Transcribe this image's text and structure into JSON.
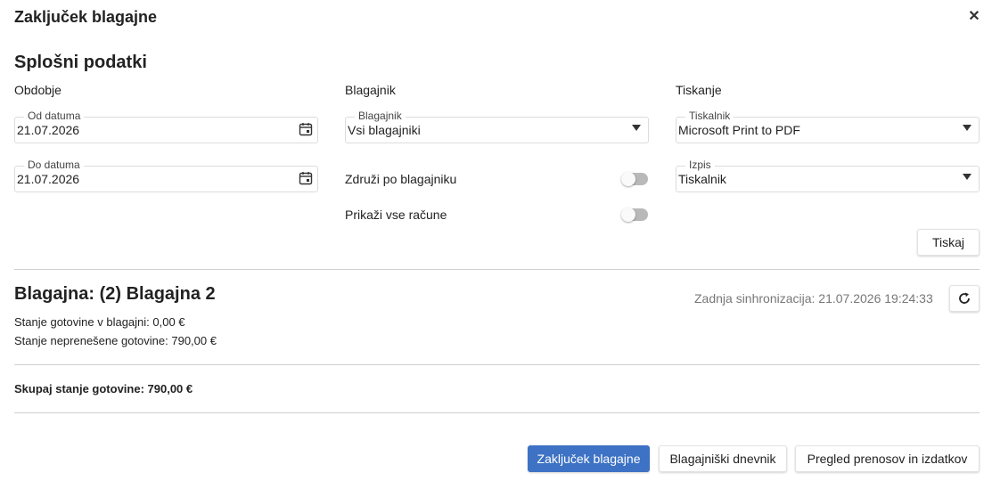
{
  "dialog": {
    "title": "Zaključek blagajne",
    "close_symbol": "✕"
  },
  "general": {
    "section_title": "Splošni podatki",
    "period": {
      "label": "Obdobje",
      "from": {
        "legend": "Od datuma",
        "value": "21.07.2026",
        "icon": "calendar-icon"
      },
      "to": {
        "legend": "Do datuma",
        "value": "21.07.2026",
        "icon": "calendar-icon"
      }
    },
    "cashier": {
      "label": "Blagajnik",
      "select": {
        "legend": "Blagajnik",
        "value": "Vsi blagajniki"
      },
      "group_by_toggle": {
        "label": "Združi po blagajniku",
        "on": false
      },
      "show_all_toggle": {
        "label": "Prikaži vse račune",
        "on": false
      }
    },
    "printing": {
      "label": "Tiskanje",
      "printer": {
        "legend": "Tiskalnik",
        "value": "Microsoft Print to PDF"
      },
      "output": {
        "legend": "Izpis",
        "value": "Tiskalnik"
      },
      "print_button": "Tiskaj"
    }
  },
  "register": {
    "title": "Blagajna: (2) Blagajna 2",
    "last_sync": "Zadnja sinhronizacija: 21.07.2026 19:24:33",
    "refresh_icon": "refresh-icon",
    "cash_balance": "Stanje gotovine v blagajni: 0,00 €",
    "untransferred_cash": "Stanje neprenešene gotovine: 790,00 €",
    "total": "Skupaj stanje gotovine: 790,00 €"
  },
  "footer": {
    "close_register_button": "Zaključek blagajne",
    "cash_journal_button": "Blagajniški dnevnik",
    "transfers_button": "Pregled prenosov in izdatkov"
  },
  "colors": {
    "primary": "#3d72c4",
    "toggle_off": "#b9b9b9",
    "divider": "#cfcfcf",
    "muted_text": "#777777"
  }
}
